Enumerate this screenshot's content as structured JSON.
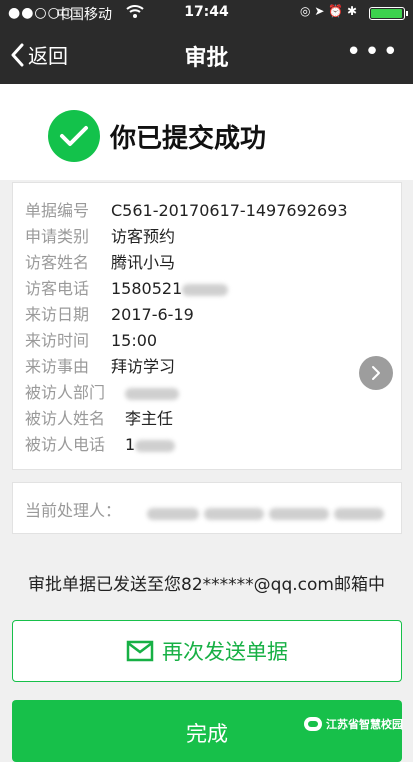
{
  "status_bar": {
    "signal": "●●○○○",
    "carrier": "中国移动",
    "wifi_icon": "wifi-icon",
    "time": "17:44",
    "icons": "◎ ➤ ⏰ ✱"
  },
  "nav": {
    "back_label": "返回",
    "title": "审批",
    "more": "•••"
  },
  "result": {
    "message": "你已提交成功",
    "icon": "check-circle-icon",
    "accent": "#13c24b"
  },
  "details": [
    {
      "key": "单据编号",
      "value": "C561-20170617-1497692693"
    },
    {
      "key": "申请类别",
      "value": "访客预约"
    },
    {
      "key": "访客姓名",
      "value": "腾讯小马"
    },
    {
      "key": "访客电话",
      "value": "1580521"
    },
    {
      "key": "来访日期",
      "value": "2017-6-19"
    },
    {
      "key": "来访时间",
      "value": "15:00"
    },
    {
      "key": "来访事由",
      "value": "拜访学习"
    },
    {
      "key": "被访人部门",
      "value": ""
    },
    {
      "key": "被访人姓名",
      "value": "李主任"
    },
    {
      "key": "被访人电话",
      "value": "1"
    }
  ],
  "handler": {
    "label": "当前处理人："
  },
  "notice": "审批单据已发送至您82******@qq.com邮箱中",
  "actions": {
    "resend_label": "再次发送单据",
    "done_label": "完成"
  },
  "watermark": "江苏省智慧校园"
}
